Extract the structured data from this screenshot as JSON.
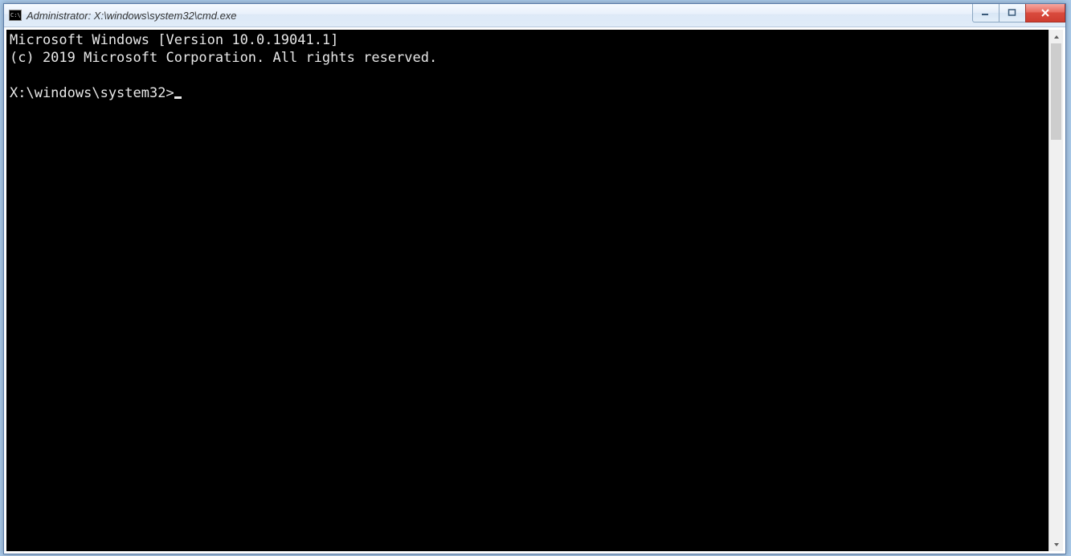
{
  "window": {
    "title": "Administrator: X:\\windows\\system32\\cmd.exe",
    "icon_glyph": "C:\\"
  },
  "terminal": {
    "line1": "Microsoft Windows [Version 10.0.19041.1]",
    "line2": "(c) 2019 Microsoft Corporation. All rights reserved.",
    "blank": "",
    "prompt": "X:\\windows\\system32>"
  }
}
